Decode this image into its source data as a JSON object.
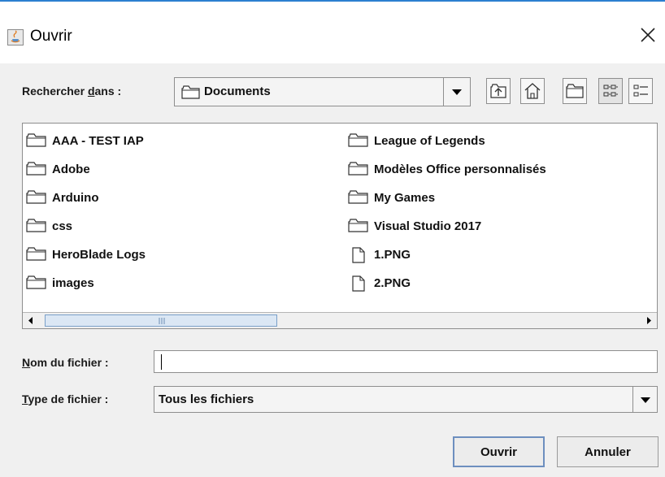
{
  "window": {
    "title": "Ouvrir"
  },
  "look_in": {
    "label_pre": "Rechercher ",
    "label_mnemonic": "d",
    "label_post": "ans :",
    "value": "Documents"
  },
  "toolbar": {
    "icons": [
      "up-one-level-icon",
      "home-icon",
      "new-folder-icon",
      "list-view-icon",
      "details-view-icon"
    ],
    "active_view": "list"
  },
  "files": {
    "col1": [
      {
        "name": "AAA - TEST IAP",
        "type": "folder"
      },
      {
        "name": "Adobe",
        "type": "folder"
      },
      {
        "name": "Arduino",
        "type": "folder"
      },
      {
        "name": "css",
        "type": "folder"
      },
      {
        "name": "HeroBlade Logs",
        "type": "folder"
      },
      {
        "name": "images",
        "type": "folder"
      }
    ],
    "col2": [
      {
        "name": "League of Legends",
        "type": "folder"
      },
      {
        "name": "Modèles Office personnalisés",
        "type": "folder"
      },
      {
        "name": "My Games",
        "type": "folder"
      },
      {
        "name": "Visual Studio 2017",
        "type": "folder"
      },
      {
        "name": "1.PNG",
        "type": "file"
      },
      {
        "name": "2.PNG",
        "type": "file"
      }
    ]
  },
  "file_name": {
    "label_mnemonic": "N",
    "label_rest": "om du fichier :",
    "value": ""
  },
  "file_type": {
    "label_mnemonic": "T",
    "label_rest": "ype de fichier :",
    "value": "Tous les fichiers"
  },
  "buttons": {
    "open": "Ouvrir",
    "cancel": "Annuler"
  },
  "colors": {
    "accent": "#2b7fd0",
    "scroll_thumb": "#dbe7f4",
    "border": "#8e8e8e"
  }
}
